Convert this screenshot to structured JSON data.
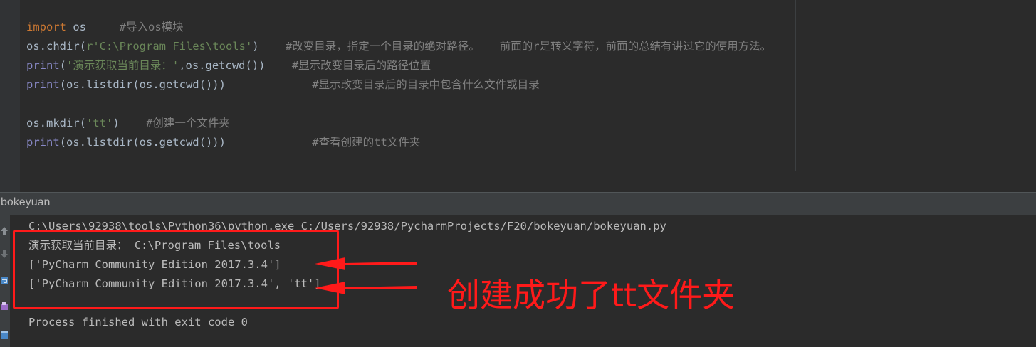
{
  "editor": {
    "lines": [
      {
        "parts": [
          {
            "t": "import",
            "c": "kw"
          },
          {
            "t": " os     ",
            "c": "id"
          },
          {
            "t": "#导入os模块",
            "c": "cm"
          }
        ]
      },
      {
        "parts": [
          {
            "t": "os.chdir(",
            "c": "id"
          },
          {
            "t": "r'C:\\Program Files\\tools'",
            "c": "str"
          },
          {
            "t": ")    ",
            "c": "id"
          },
          {
            "t": "#改变目录，指定一个目录的绝对路径。   前面的r是转义字符，前面的总结有讲过它的使用方法。",
            "c": "cm"
          }
        ]
      },
      {
        "parts": [
          {
            "t": "print",
            "c": "bi"
          },
          {
            "t": "(",
            "c": "id"
          },
          {
            "t": "'演示获取当前目录：'",
            "c": "str"
          },
          {
            "t": ",os.getcwd())    ",
            "c": "id"
          },
          {
            "t": "#显示改变目录后的路径位置",
            "c": "cm"
          }
        ]
      },
      {
        "parts": [
          {
            "t": "print",
            "c": "bi"
          },
          {
            "t": "(os.listdir(os.getcwd()))             ",
            "c": "id"
          },
          {
            "t": "#显示改变目录后的目录中包含什么文件或目录",
            "c": "cm"
          }
        ]
      },
      {
        "parts": []
      },
      {
        "parts": [
          {
            "t": "os.mkdir(",
            "c": "id"
          },
          {
            "t": "'tt'",
            "c": "str"
          },
          {
            "t": ")    ",
            "c": "id"
          },
          {
            "t": "#创建一个文件夹",
            "c": "cm"
          }
        ]
      },
      {
        "parts": [
          {
            "t": "print",
            "c": "bi"
          },
          {
            "t": "(os.listdir(os.getcwd()))             ",
            "c": "id"
          },
          {
            "t": "#查看创建的tt文件夹",
            "c": "cm"
          }
        ]
      }
    ]
  },
  "run_panel": {
    "tab_title": "bokeyuan",
    "output": [
      "C:\\Users\\92938\\tools\\Python36\\python.exe C:/Users/92938/PycharmProjects/F20/bokeyuan/bokeyuan.py",
      "演示获取当前目录： C:\\Program Files\\tools",
      "['PyCharm Community Edition 2017.3.4']",
      "['PyCharm Community Edition 2017.3.4', 'tt']",
      "",
      "Process finished with exit code 0"
    ]
  },
  "annotation": {
    "text": "创建成功了tt文件夹",
    "color": "#ff1a1a"
  },
  "icons": [
    "up-arrow-icon",
    "down-arrow-icon",
    "soft-wrap-icon",
    "print-icon",
    "clear-all-icon"
  ]
}
